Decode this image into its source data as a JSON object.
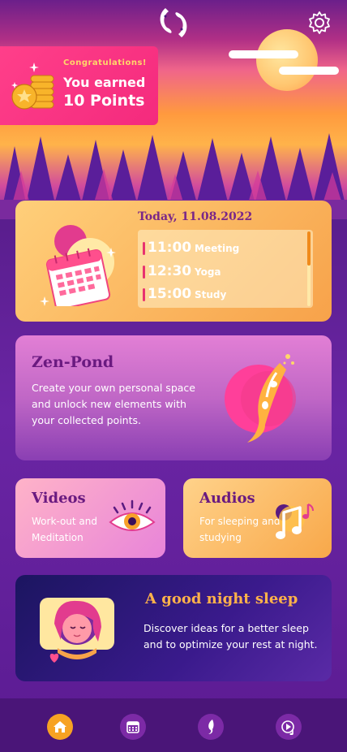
{
  "header": {
    "logo_icon": "koi-fish-logo-icon",
    "settings_icon": "gear-icon"
  },
  "reward": {
    "congrats": "Congratulations!",
    "line1": "You earned",
    "line2": "10 Points",
    "icon": "coin-stack-icon"
  },
  "today": {
    "title": "Today, 11.08.2022",
    "icon": "calendar-icon",
    "items": [
      {
        "time": "11:00",
        "activity": "Meeting"
      },
      {
        "time": "12:30",
        "activity": "Yoga"
      },
      {
        "time": "15:00",
        "activity": "Study"
      }
    ]
  },
  "zen": {
    "title": "Zen-Pond",
    "description": "Create your own personal space and unlock new elements with your collected points.",
    "icon": "koi-fish-icon"
  },
  "videos": {
    "title": "Videos",
    "description": "Work-out and Meditation",
    "icon": "eye-icon"
  },
  "audios": {
    "title": "Audios",
    "description": "For sleeping and studying",
    "icon": "music-note-icon"
  },
  "sleep": {
    "title": "A good night sleep",
    "description": "Discover ideas for a better sleep and to optimize your rest at night.",
    "icon": "sleeping-girl-icon"
  },
  "nav": {
    "items": [
      {
        "name": "home",
        "icon": "home-icon",
        "active": true
      },
      {
        "name": "calendar",
        "icon": "calendar-icon",
        "active": false
      },
      {
        "name": "zen-pond",
        "icon": "fish-icon",
        "active": false
      },
      {
        "name": "media",
        "icon": "media-icon",
        "active": false
      }
    ]
  },
  "colors": {
    "accent": "#f7a223",
    "pink": "#f42a7d",
    "purple": "#6a1a80",
    "nav_bg": "#4a1578"
  }
}
